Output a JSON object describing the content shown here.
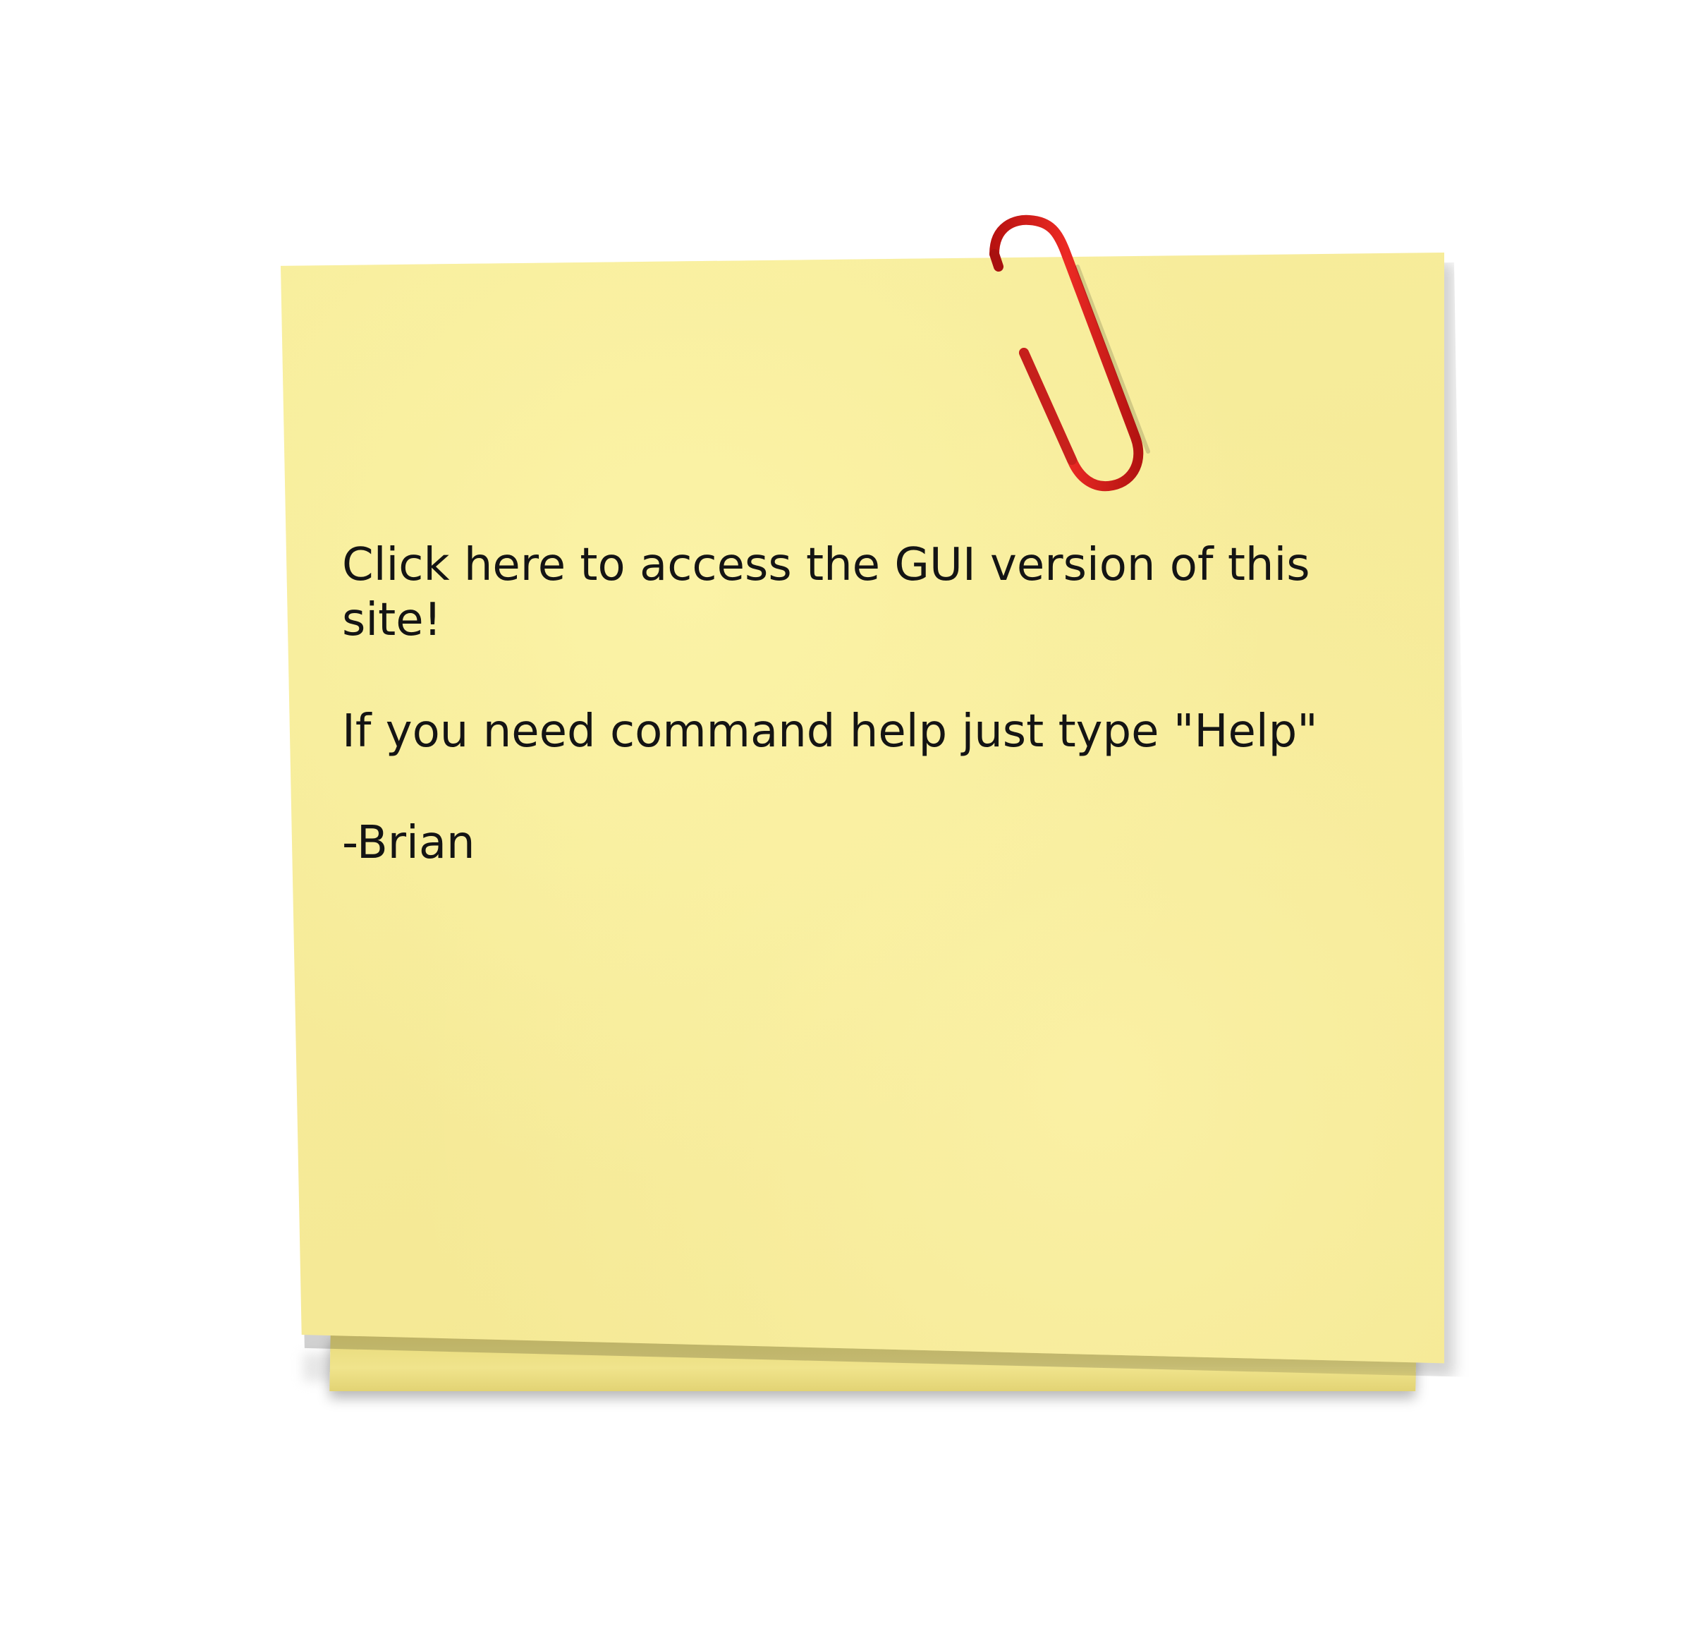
{
  "note": {
    "link_text": "Click here to access the GUI version of this site!",
    "help_text": "If you need command help just type \"Help\"",
    "signature": "-Brian"
  },
  "icons": {
    "clip": "paperclip-icon"
  },
  "colors": {
    "note_yellow": "#f6eb99",
    "clip_red": "#e0201e",
    "text": "#141414"
  }
}
